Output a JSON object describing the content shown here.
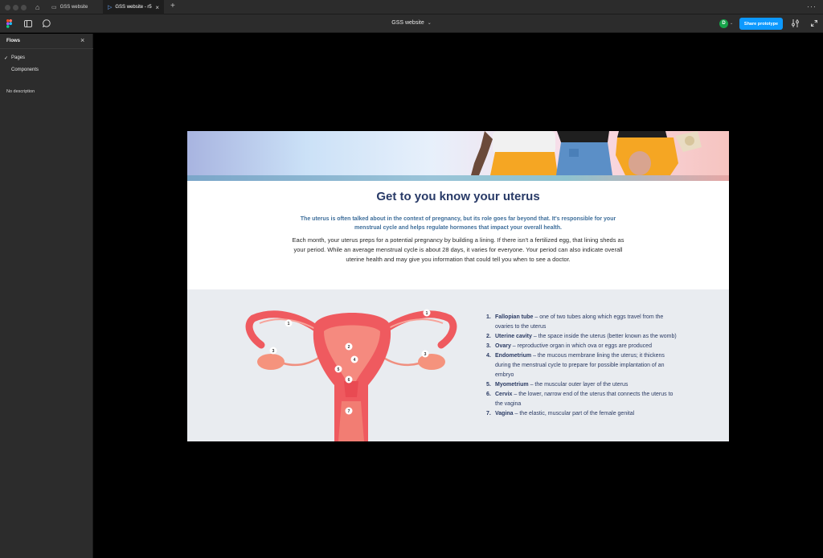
{
  "window": {
    "tabs": [
      {
        "label": "GSS website",
        "active": false
      },
      {
        "label": "GSS website - r5",
        "active": true
      }
    ]
  },
  "toolbar": {
    "file_title": "GSS website",
    "avatar_initial": "D",
    "share_label": "Share prototype"
  },
  "sidebar": {
    "title": "Flows",
    "items": [
      {
        "label": "Pages",
        "checked": true
      },
      {
        "label": "Components",
        "checked": false
      }
    ],
    "description": "No description"
  },
  "content": {
    "title": "Get to you know your uterus",
    "lead": "The uterus is often talked about in the context of pregnancy, but its role goes far beyond that. It's responsible for your menstrual cycle and helps regulate hormones that impact your overall health.",
    "body": "Each month, your uterus preps for a potential pregnancy by building a lining. If there isn't a fertilized egg, that lining sheds as your period. While an average menstrual cycle is about 28 days, it varies for everyone. Your period can also indicate overall uterine health and may give you information that could tell you when to see a doctor.",
    "diagram_labels": [
      "1",
      "1",
      "2",
      "3",
      "3",
      "4",
      "5",
      "6",
      "7"
    ],
    "parts": [
      {
        "num": "1.",
        "term": "Fallopian tube",
        "desc": " – one of two tubes along which eggs travel from the ovaries to the uterus"
      },
      {
        "num": "2.",
        "term": "Uterine cavity",
        "desc": " – the space inside the uterus (better known as the womb)"
      },
      {
        "num": "3.",
        "term": "Ovary",
        "desc": " – reproductive organ in which ova or eggs are produced"
      },
      {
        "num": "4.",
        "term": "Endometrium",
        "desc": " – the mucous membrane lining the uterus; it thickens during the menstrual cycle to prepare for possible implantation of an embryo"
      },
      {
        "num": "5.",
        "term": "Myometrium",
        "desc": " – the muscular outer layer of the uterus"
      },
      {
        "num": "6.",
        "term": "Cervix",
        "desc": " – the lower, narrow end of the uterus that connects the uterus to the vagina"
      },
      {
        "num": "7.",
        "term": "Vagina",
        "desc": " – the elastic, muscular part of the female genital"
      }
    ]
  },
  "colors": {
    "accent_blue": "#0d99ff",
    "title_navy": "#283a67",
    "lead_blue": "#3f6f9b",
    "uterus_red": "#ef5a5f",
    "section_gray": "#e9ecf0"
  }
}
